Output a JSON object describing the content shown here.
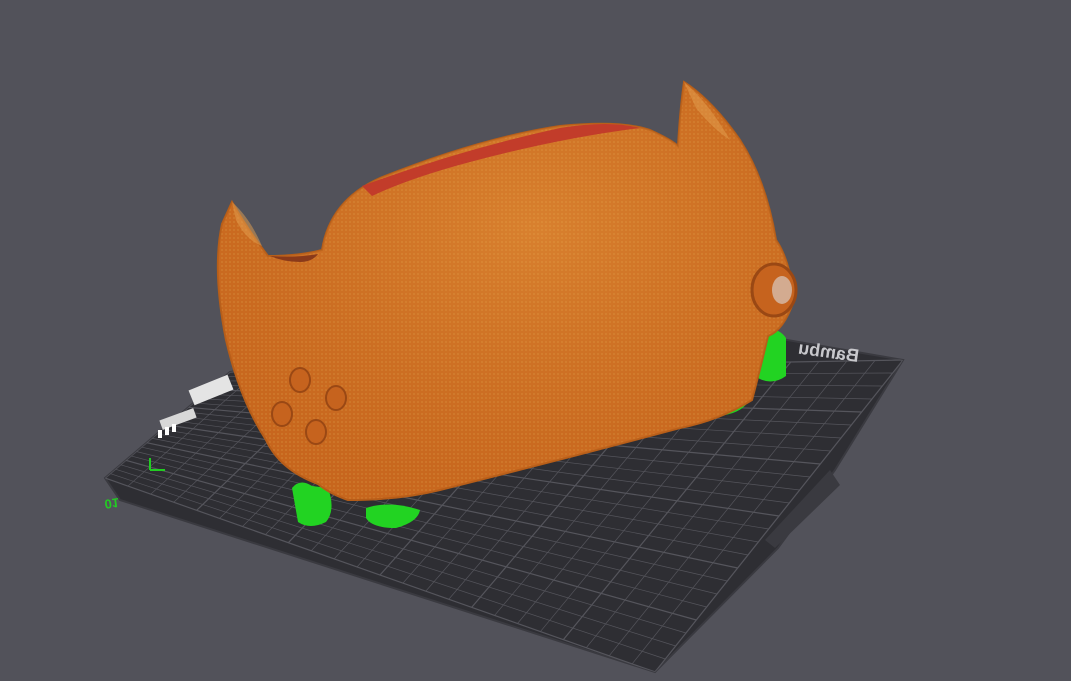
{
  "viewport": {
    "background_color": "#52525a"
  },
  "build_plate": {
    "brand_text": "Bambu",
    "plate_number": "01",
    "origin_marker_color": "#22cc22",
    "plate_color": "#2e2e33",
    "grid_color": "#55555c"
  },
  "model": {
    "body_color": "#d06e22",
    "highlight_color": "#e8a040",
    "top_edge_color": "#c03a28",
    "support_color": "#22d322"
  }
}
